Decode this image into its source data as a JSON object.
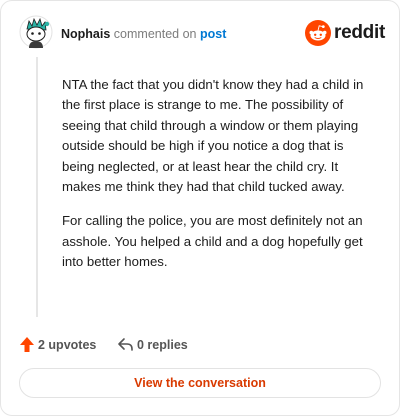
{
  "header": {
    "username": "Nophais",
    "action_text": "commented on",
    "post_link": "post",
    "brand": {
      "wordmark": "reddit",
      "icon": "reddit-logo-icon",
      "color": "#ff4500"
    },
    "avatar_icon": "snoo-avatar-icon"
  },
  "comment": {
    "paragraphs": [
      "NTA the fact that you didn't know they had a child in the first place is strange to me. The possibility of seeing that child through a window or them playing outside should be high if you notice a dog that is being neglected, or at least hear the child cry. It makes me think they had that child tucked away.",
      "For calling the police, you are most definitely not an asshole. You helped a child and a dog hopefully get into better homes."
    ]
  },
  "actions": {
    "upvotes_label": "2 upvotes",
    "upvote_icon": "upvote-arrow-icon",
    "upvote_color": "#ff4500",
    "replies_label": "0 replies",
    "reply_icon": "reply-arrow-icon"
  },
  "cta": {
    "label": "View the conversation",
    "color": "#d93a00"
  }
}
